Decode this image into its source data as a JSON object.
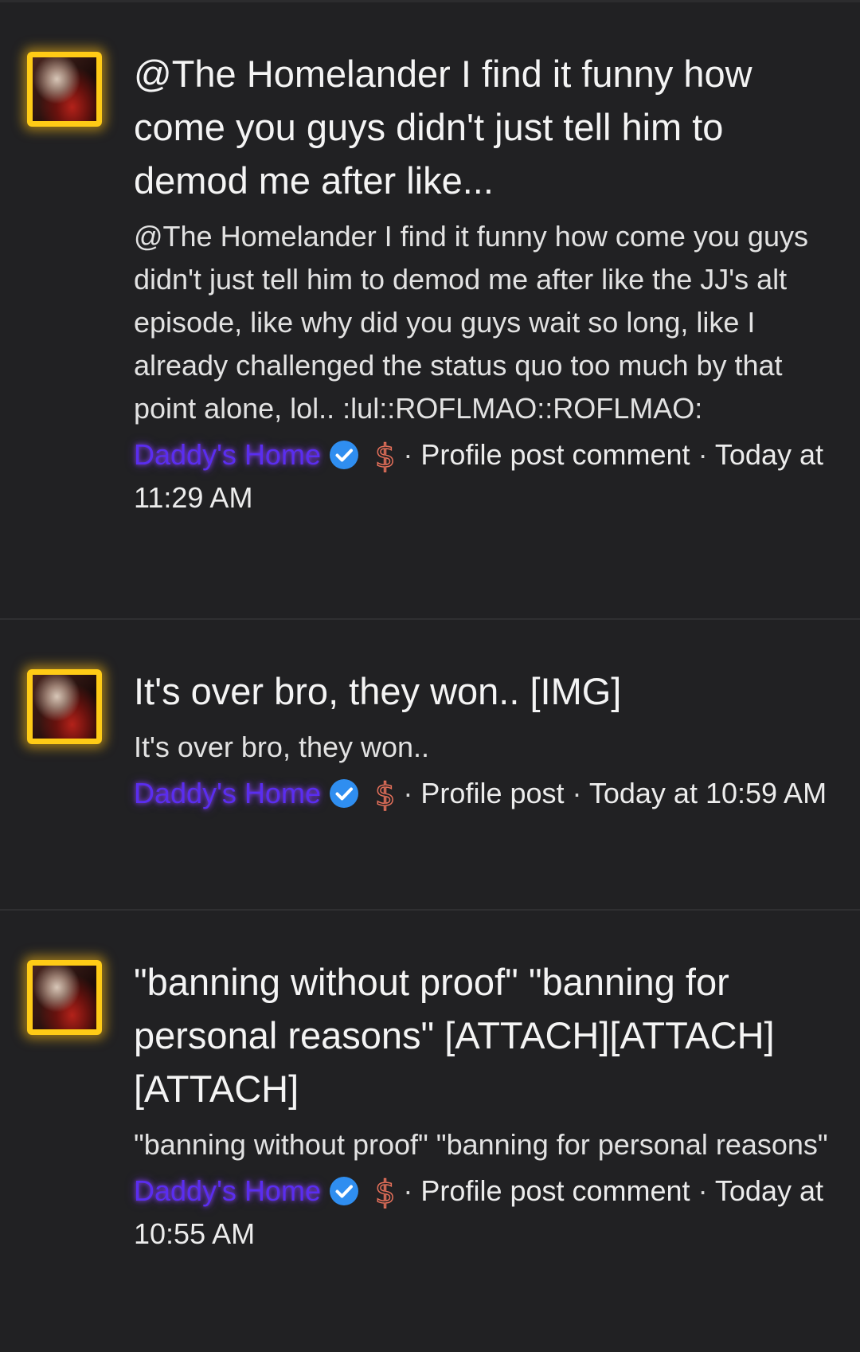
{
  "posts": [
    {
      "title": "@The Homelander I find it funny how come you guys didn't just tell him to demod me after like...",
      "snippet": "@The Homelander I find it funny how come you guys didn't just tell him to demod me after like the JJ's alt episode, like why did you guys wait so long, like I already challenged the status quo too much by that point alone, lol.. :lul::ROFLMAO::ROFLMAO:",
      "username": "Daddy's Home",
      "type": "Profile post comment",
      "time": "Today at 11:29 AM"
    },
    {
      "title": "It's over bro, they won.. [IMG]",
      "snippet": "It's over bro, they won..",
      "username": "Daddy's Home",
      "type": "Profile post",
      "time": "Today at 10:59 AM"
    },
    {
      "title": "\"banning without proof\" \"banning for personal reasons\" [ATTACH][ATTACH][ATTACH]",
      "snippet": "\"banning without proof\" \"banning for personal reasons\"",
      "username": "Daddy's Home",
      "type": "Profile post comment",
      "time": "Today at 10:55 AM"
    }
  ],
  "icons": {
    "verified": "verified-check-icon",
    "dollar": "dollar-icon",
    "avatar": "avatar"
  },
  "colors": {
    "background": "#212123",
    "avatar_border": "#ffcb16",
    "username": "#5a2df0",
    "verified": "#2f8ef0",
    "dollar": "#e8715b"
  }
}
